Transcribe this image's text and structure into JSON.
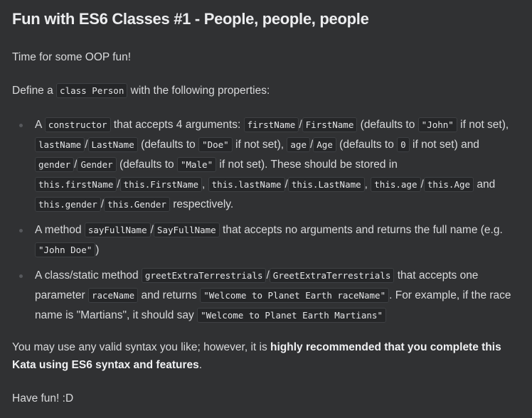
{
  "title": "Fun with ES6 Classes #1 - People, people, people",
  "intro": "Time for some OOP fun!",
  "define": {
    "pre": "Define a",
    "code": "class Person",
    "post": "with the following properties:"
  },
  "item1": {
    "t1": "A",
    "c1": "constructor",
    "t2": "that accepts 4 arguments:",
    "c2": "firstName",
    "s1": "/",
    "c3": "FirstName",
    "t3": "(defaults to",
    "c4": "\"John\"",
    "t4": "if not set),",
    "c5": "lastName",
    "s2": "/",
    "c6": "LastName",
    "t5": "(defaults to",
    "c7": "\"Doe\"",
    "t6": "if not set),",
    "c8": "age",
    "s3": "/",
    "c9": "Age",
    "t7": "(defaults to",
    "c10": "0",
    "t8": "if not set) and",
    "c11": "gender",
    "s4": "/",
    "c12": "Gender",
    "t9": "(defaults to",
    "c13": "\"Male\"",
    "t10": "if not set). These should be stored in",
    "c14": "this.firstName",
    "s5": "/",
    "c15": "this.FirstName",
    "t11": ",",
    "c16": "this.lastName",
    "s6": "/",
    "c17": "this.LastName",
    "t12": ",",
    "c18": "this.age",
    "s7": "/",
    "c19": "this.Age",
    "t13": "and",
    "c20": "this.gender",
    "s8": "/",
    "c21": "this.Gender",
    "t14": "respectively."
  },
  "item2": {
    "t1": "A method",
    "c1": "sayFullName",
    "s1": "/",
    "c2": "SayFullName",
    "t2": "that accepts no arguments and returns the full name (e.g.",
    "c3": "\"John Doe\"",
    "t3": ")"
  },
  "item3": {
    "t1": "A class/static method",
    "c1": "greetExtraTerrestrials",
    "s1": "/",
    "c2": "GreetExtraTerrestrials",
    "t2": "that accepts one parameter",
    "c3": "raceName",
    "t3": "and returns",
    "c4": "\"Welcome to Planet Earth raceName\"",
    "t4": ". For example, if the race name is \"Martians\", it should say",
    "c5": "\"Welcome to Planet Earth Martians\""
  },
  "syntax": {
    "pre": "You may use any valid syntax you like; however, it is",
    "strong": "highly recommended that you complete this Kata using ES6 syntax and features",
    "post": "."
  },
  "outro": "Have fun! :D"
}
